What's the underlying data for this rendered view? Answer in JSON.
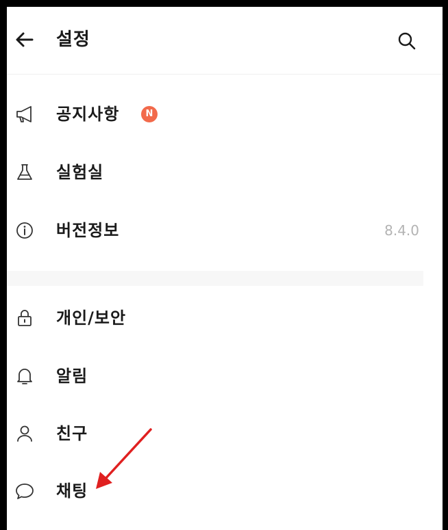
{
  "header": {
    "title": "설정",
    "back_icon": "arrow-left-icon",
    "search_icon": "search-icon"
  },
  "menu": {
    "items": [
      {
        "label": "공지사항",
        "icon": "megaphone-icon",
        "badge": "N"
      },
      {
        "label": "실험실",
        "icon": "flask-icon"
      },
      {
        "label": "버전정보",
        "icon": "info-icon",
        "value": "8.4.0"
      },
      {
        "label": "개인/보안",
        "icon": "lock-icon"
      },
      {
        "label": "알림",
        "icon": "bell-icon"
      },
      {
        "label": "친구",
        "icon": "person-icon"
      },
      {
        "label": "채팅",
        "icon": "chat-bubble-icon"
      }
    ]
  },
  "colors": {
    "badge": "#f26a4b",
    "annotation_arrow": "#e02020",
    "version_text": "#b3b3b3"
  }
}
